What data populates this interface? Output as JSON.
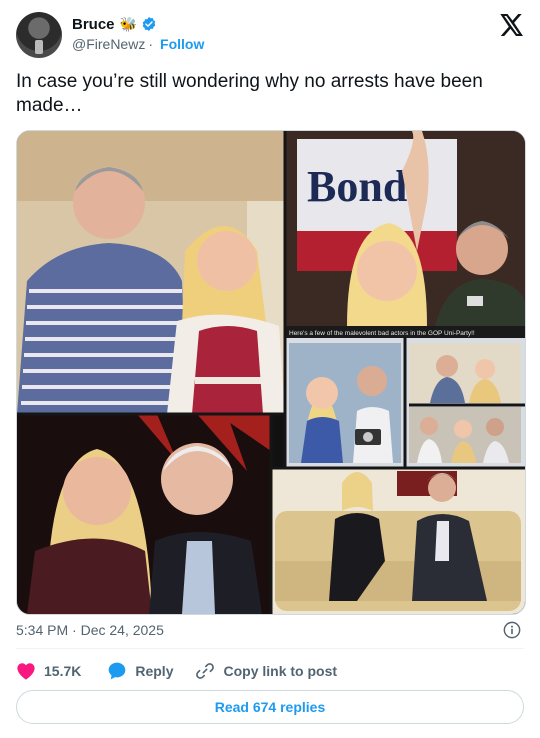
{
  "author": {
    "name": "Bruce",
    "emoji": "🐝",
    "handle": "@FireNewz",
    "separator": "·",
    "follow_label": "Follow"
  },
  "tweet": {
    "text": "In case you’re still wondering why no arrests have been made…",
    "timestamp": "5:34 PM · Dec 24, 2025"
  },
  "media": {
    "sign_text": "Bondi",
    "caption_strip": "Here's a few of the malevolent bad actors in the GOP Uni-Party!!"
  },
  "actions": {
    "likes": "15.7K",
    "reply_label": "Reply",
    "copy_label": "Copy link to post"
  },
  "read_replies_label": "Read 674 replies",
  "colors": {
    "accent": "#1d9bf0",
    "like": "#f91880",
    "secondary_text": "#536471"
  },
  "icons": [
    "verified-badge-icon",
    "x-logo-icon",
    "info-icon",
    "heart-icon",
    "reply-bubble-icon",
    "link-icon"
  ]
}
